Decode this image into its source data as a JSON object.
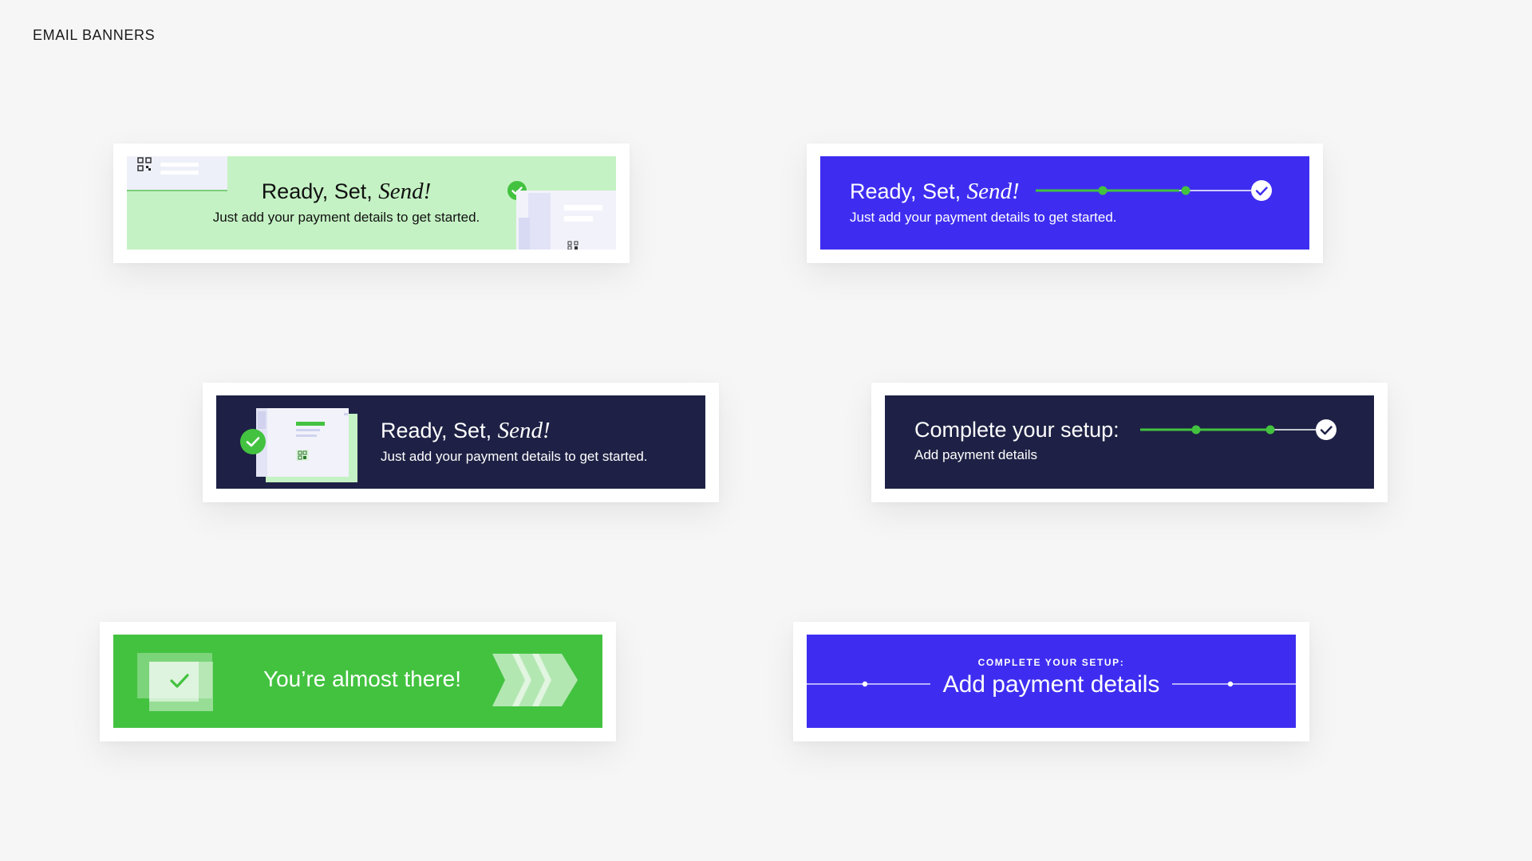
{
  "page": {
    "title": "EMAIL BANNERS"
  },
  "banners": [
    {
      "id": "green-illustrated",
      "headline_prefix": "Ready, Set, ",
      "headline_emphasis": "Send!",
      "subline": "Just add your payment details to get started.",
      "background": "#c5f2c4"
    },
    {
      "id": "purple-progress",
      "headline_prefix": "Ready, Set, ",
      "headline_emphasis": "Send!",
      "subline": "Just add your payment details to get started.",
      "background": "#3e2df0",
      "progress_steps_complete": 2,
      "progress_steps_total": 3
    },
    {
      "id": "navy-illustrated",
      "headline_prefix": "Ready, Set, ",
      "headline_emphasis": "Send!",
      "subline": "Just add your payment details to get started.",
      "background": "#1e2145"
    },
    {
      "id": "navy-progress",
      "headline": "Complete your setup:",
      "subline": "Add payment details",
      "background": "#1e2145",
      "progress_steps_complete": 2,
      "progress_steps_total": 3
    },
    {
      "id": "green-almost",
      "headline": "You’re almost there!",
      "background": "#43c240"
    },
    {
      "id": "purple-centered",
      "eyebrow": "COMPLETE YOUR SETUP:",
      "headline": "Add payment details",
      "background": "#3e2df0"
    }
  ],
  "colors": {
    "accent_green": "#43c240",
    "purple": "#3e2df0",
    "navy": "#1e2145",
    "page_bg": "#f6f6f6"
  },
  "icons": [
    "qr-code-icon",
    "checkmark-circle-icon",
    "progress-track-icon",
    "chevron-arrows-icon"
  ]
}
